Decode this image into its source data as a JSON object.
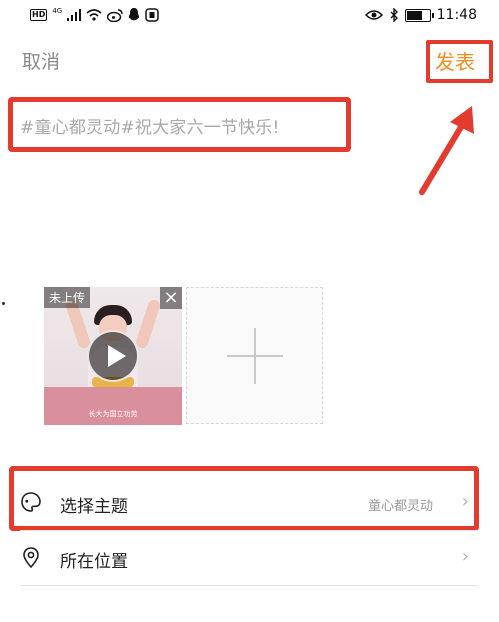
{
  "status_bar": {
    "left_icons": [
      "hd-volte-icon",
      "signal-4g-icon",
      "wifi-icon",
      "weibo-icon",
      "qq-icon",
      "app-icon"
    ],
    "hd_label": "HD",
    "net_label": "4G",
    "right_icons": [
      "eye-icon",
      "bluetooth-icon",
      "battery-icon"
    ],
    "time": "11:48"
  },
  "header": {
    "cancel_label": "取消",
    "publish_label": "发表",
    "publish_color": "#f08d1c"
  },
  "post": {
    "text": "#童心都灵动#祝大家六一节快乐!"
  },
  "media": {
    "upload_status": "未上传",
    "close_icon": "×",
    "video_caption": "长大为国立功劳",
    "add_icon": "plus-icon"
  },
  "options": [
    {
      "label": "选择主题",
      "value": "童心都灵动",
      "icon": "palette-icon"
    },
    {
      "label": "所在位置",
      "value": "",
      "icon": "location-pin-icon"
    }
  ],
  "chevron": "›",
  "annotation_color": "#e33b2e"
}
